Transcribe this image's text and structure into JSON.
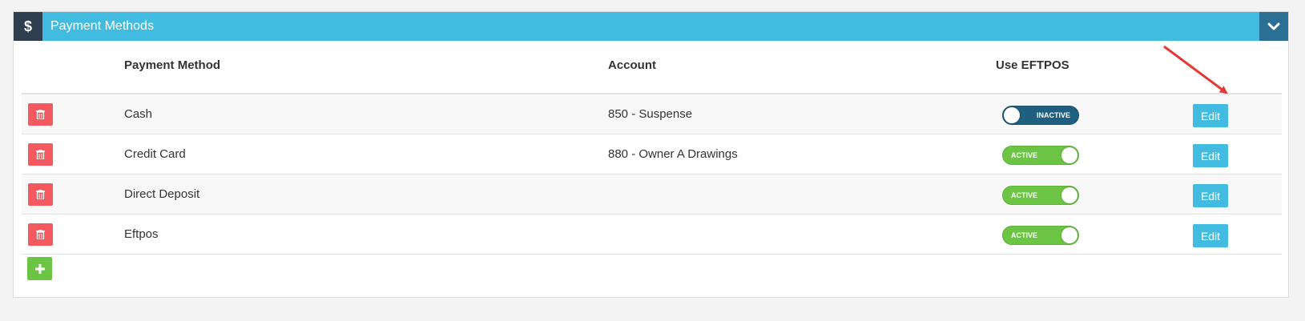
{
  "panel": {
    "header_icon": "$",
    "title": "Payment Methods",
    "collapse_icon": "chevron-down-icon"
  },
  "table": {
    "columns": [
      "Payment Method",
      "Account",
      "Use EFTPOS"
    ],
    "rows": [
      {
        "method": "Cash",
        "account": "850 - Suspense",
        "eftpos": "INACTIVE",
        "edit": "Edit"
      },
      {
        "method": "Credit Card",
        "account": "880 - Owner A Drawings",
        "eftpos": "ACTIVE",
        "edit": "Edit"
      },
      {
        "method": "Direct Deposit",
        "account": "",
        "eftpos": "ACTIVE",
        "edit": "Edit"
      },
      {
        "method": "Eftpos",
        "account": "",
        "eftpos": "ACTIVE",
        "edit": "Edit"
      }
    ]
  },
  "colors": {
    "header": "#41bce0",
    "header_icon_bg": "#2f3e4e",
    "delete": "#f4595f",
    "active": "#6cc444",
    "inactive": "#1f5f80",
    "annotation_arrow": "#e53935"
  }
}
